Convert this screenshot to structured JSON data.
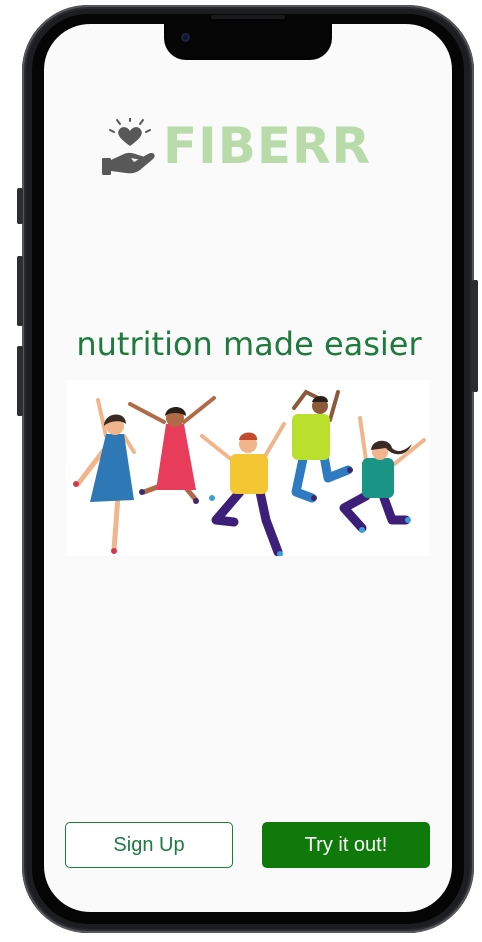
{
  "app": {
    "brand_name": "FIBERR",
    "brand_color": "#b9dbaa",
    "accent_color": "#1f7a3e",
    "primary_button_color": "#0f7a0a"
  },
  "logo": {
    "icon": "hand-holding-heart-icon"
  },
  "tagline": "nutrition made easier",
  "hero": {
    "illustration": "five people jumping in celebration"
  },
  "actions": {
    "signup_label": "Sign Up",
    "try_label": "Try it out!"
  }
}
